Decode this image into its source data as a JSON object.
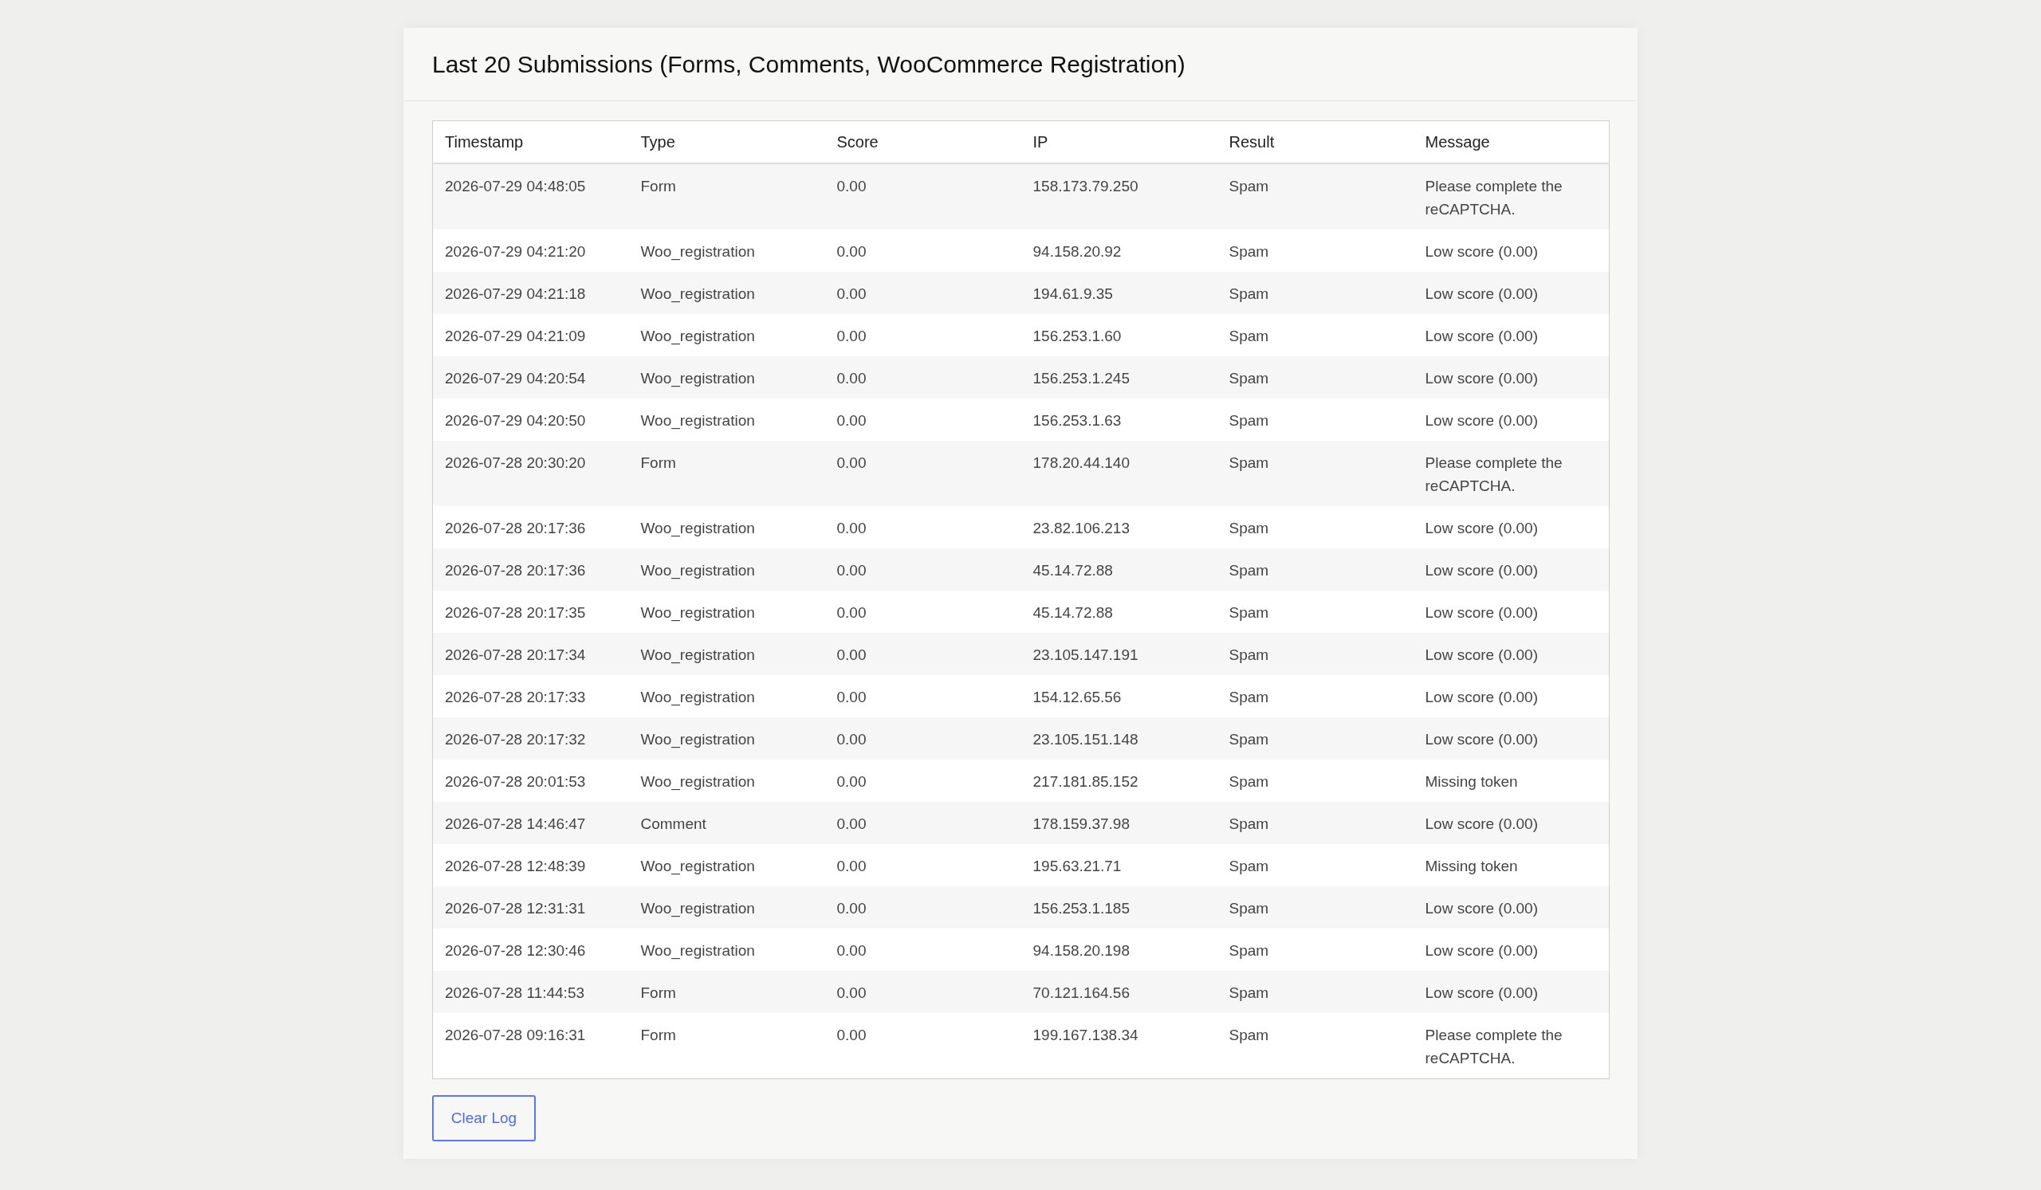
{
  "panel": {
    "title": "Last 20 Submissions (Forms, Comments, WooCommerce Registration)"
  },
  "table": {
    "columns": [
      "Timestamp",
      "Type",
      "Score",
      "IP",
      "Result",
      "Message"
    ],
    "rows": [
      [
        "2026-07-29 04:48:05",
        "Form",
        "0.00",
        "158.173.79.250",
        "Spam",
        "Please complete the reCAPTCHA."
      ],
      [
        "2026-07-29 04:21:20",
        "Woo_registration",
        "0.00",
        "94.158.20.92",
        "Spam",
        "Low score (0.00)"
      ],
      [
        "2026-07-29 04:21:18",
        "Woo_registration",
        "0.00",
        "194.61.9.35",
        "Spam",
        "Low score (0.00)"
      ],
      [
        "2026-07-29 04:21:09",
        "Woo_registration",
        "0.00",
        "156.253.1.60",
        "Spam",
        "Low score (0.00)"
      ],
      [
        "2026-07-29 04:20:54",
        "Woo_registration",
        "0.00",
        "156.253.1.245",
        "Spam",
        "Low score (0.00)"
      ],
      [
        "2026-07-29 04:20:50",
        "Woo_registration",
        "0.00",
        "156.253.1.63",
        "Spam",
        "Low score (0.00)"
      ],
      [
        "2026-07-28 20:30:20",
        "Form",
        "0.00",
        "178.20.44.140",
        "Spam",
        "Please complete the reCAPTCHA."
      ],
      [
        "2026-07-28 20:17:36",
        "Woo_registration",
        "0.00",
        "23.82.106.213",
        "Spam",
        "Low score (0.00)"
      ],
      [
        "2026-07-28 20:17:36",
        "Woo_registration",
        "0.00",
        "45.14.72.88",
        "Spam",
        "Low score (0.00)"
      ],
      [
        "2026-07-28 20:17:35",
        "Woo_registration",
        "0.00",
        "45.14.72.88",
        "Spam",
        "Low score (0.00)"
      ],
      [
        "2026-07-28 20:17:34",
        "Woo_registration",
        "0.00",
        "23.105.147.191",
        "Spam",
        "Low score (0.00)"
      ],
      [
        "2026-07-28 20:17:33",
        "Woo_registration",
        "0.00",
        "154.12.65.56",
        "Spam",
        "Low score (0.00)"
      ],
      [
        "2026-07-28 20:17:32",
        "Woo_registration",
        "0.00",
        "23.105.151.148",
        "Spam",
        "Low score (0.00)"
      ],
      [
        "2026-07-28 20:01:53",
        "Woo_registration",
        "0.00",
        "217.181.85.152",
        "Spam",
        "Missing token"
      ],
      [
        "2026-07-28 14:46:47",
        "Comment",
        "0.00",
        "178.159.37.98",
        "Spam",
        "Low score (0.00)"
      ],
      [
        "2026-07-28 12:48:39",
        "Woo_registration",
        "0.00",
        "195.63.21.71",
        "Spam",
        "Missing token"
      ],
      [
        "2026-07-28 12:31:31",
        "Woo_registration",
        "0.00",
        "156.253.1.185",
        "Spam",
        "Low score (0.00)"
      ],
      [
        "2026-07-28 12:30:46",
        "Woo_registration",
        "0.00",
        "94.158.20.198",
        "Spam",
        "Low score (0.00)"
      ],
      [
        "2026-07-28 11:44:53",
        "Form",
        "0.00",
        "70.121.164.56",
        "Spam",
        "Low score (0.00)"
      ],
      [
        "2026-07-28 09:16:31",
        "Form",
        "0.00",
        "199.167.138.34",
        "Spam",
        "Please complete the reCAPTCHA."
      ]
    ]
  },
  "clear_button": {
    "label": "Clear Log"
  }
}
